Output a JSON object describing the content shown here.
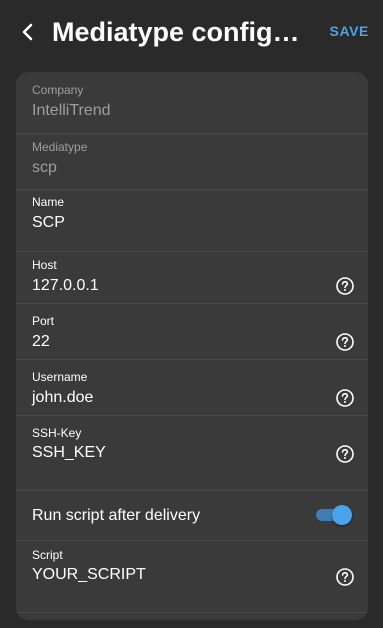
{
  "header": {
    "title": "Mediatype configur…",
    "save_label": "SAVE"
  },
  "fields": {
    "company": {
      "label": "Company",
      "value": "IntelliTrend"
    },
    "mediatype": {
      "label": "Mediatype",
      "value": "scp"
    },
    "name": {
      "label": "Name",
      "value": "SCP"
    },
    "host": {
      "label": "Host",
      "value": "127.0.0.1"
    },
    "port": {
      "label": "Port",
      "value": "22"
    },
    "username": {
      "label": "Username",
      "value": "john.doe"
    },
    "ssh_key": {
      "label": "SSH-Key",
      "value": "SSH_KEY"
    },
    "run_script": {
      "label": "Run script after delivery",
      "enabled": true
    },
    "script": {
      "label": "Script",
      "value": "YOUR_SCRIPT"
    }
  },
  "colors": {
    "background": "#2a2a2a",
    "card": "#3a3a3a",
    "accent": "#4aa3e8",
    "muted_text": "#9e9e9e"
  },
  "icons": {
    "back": "chevron-left-icon",
    "help": "help-circle-icon"
  }
}
